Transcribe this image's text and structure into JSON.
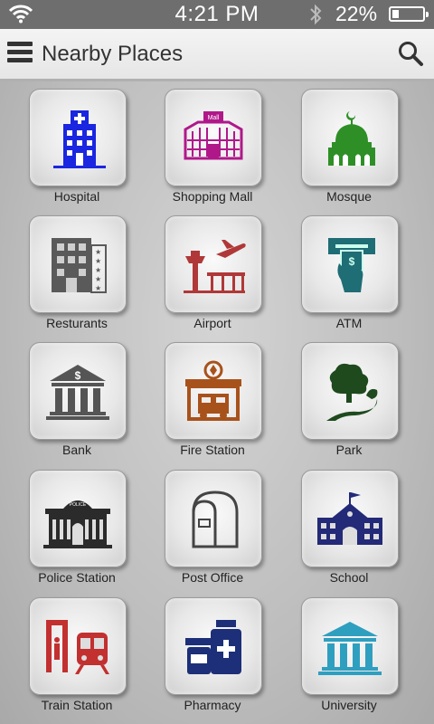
{
  "status_bar": {
    "time": "4:21 PM",
    "battery_percent": "22%",
    "battery_level": 0.22
  },
  "app_bar": {
    "title": "Nearby Places"
  },
  "places": [
    {
      "label": "Hospital",
      "icon": "hospital-icon",
      "color": "#1a26e0"
    },
    {
      "label": "Shopping Mall",
      "icon": "shopping-mall-icon",
      "color": "#b0188a"
    },
    {
      "label": "Mosque",
      "icon": "mosque-icon",
      "color": "#2e8f26"
    },
    {
      "label": "Resturants",
      "icon": "restaurant-icon",
      "color": "#5a5a5a"
    },
    {
      "label": "Airport",
      "icon": "airport-icon",
      "color": "#b03838"
    },
    {
      "label": "ATM",
      "icon": "atm-icon",
      "color": "#1f6d75"
    },
    {
      "label": "Bank",
      "icon": "bank-icon",
      "color": "#555555"
    },
    {
      "label": "Fire Station",
      "icon": "fire-station-icon",
      "color": "#a8521b"
    },
    {
      "label": "Park",
      "icon": "park-icon",
      "color": "#1e4a1e"
    },
    {
      "label": "Police Station",
      "icon": "police-station-icon",
      "color": "#2b2b2b"
    },
    {
      "label": "Post Office",
      "icon": "post-office-icon",
      "color": "#444444"
    },
    {
      "label": "School",
      "icon": "school-icon",
      "color": "#232a78"
    },
    {
      "label": "Train Station",
      "icon": "train-station-icon",
      "color": "#c23030"
    },
    {
      "label": "Pharmacy",
      "icon": "pharmacy-icon",
      "color": "#1c2f78"
    },
    {
      "label": "University",
      "icon": "university-icon",
      "color": "#2f9fc0"
    }
  ]
}
